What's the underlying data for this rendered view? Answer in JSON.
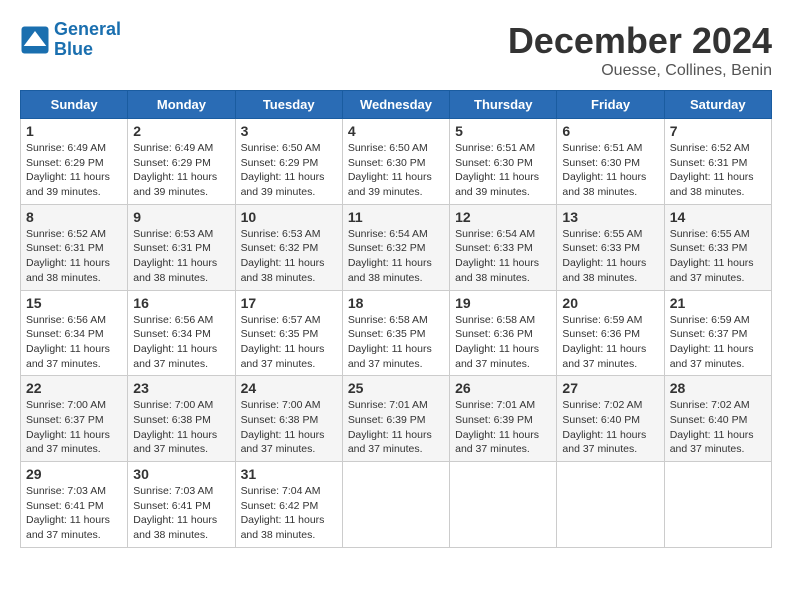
{
  "logo": {
    "text_general": "General",
    "text_blue": "Blue"
  },
  "header": {
    "month": "December 2024",
    "location": "Ouesse, Collines, Benin"
  },
  "weekdays": [
    "Sunday",
    "Monday",
    "Tuesday",
    "Wednesday",
    "Thursday",
    "Friday",
    "Saturday"
  ],
  "weeks": [
    [
      {
        "day": "1",
        "sunrise": "6:49 AM",
        "sunset": "6:29 PM",
        "daylight": "11 hours and 39 minutes."
      },
      {
        "day": "2",
        "sunrise": "6:49 AM",
        "sunset": "6:29 PM",
        "daylight": "11 hours and 39 minutes."
      },
      {
        "day": "3",
        "sunrise": "6:50 AM",
        "sunset": "6:29 PM",
        "daylight": "11 hours and 39 minutes."
      },
      {
        "day": "4",
        "sunrise": "6:50 AM",
        "sunset": "6:30 PM",
        "daylight": "11 hours and 39 minutes."
      },
      {
        "day": "5",
        "sunrise": "6:51 AM",
        "sunset": "6:30 PM",
        "daylight": "11 hours and 39 minutes."
      },
      {
        "day": "6",
        "sunrise": "6:51 AM",
        "sunset": "6:30 PM",
        "daylight": "11 hours and 38 minutes."
      },
      {
        "day": "7",
        "sunrise": "6:52 AM",
        "sunset": "6:31 PM",
        "daylight": "11 hours and 38 minutes."
      }
    ],
    [
      {
        "day": "8",
        "sunrise": "6:52 AM",
        "sunset": "6:31 PM",
        "daylight": "11 hours and 38 minutes."
      },
      {
        "day": "9",
        "sunrise": "6:53 AM",
        "sunset": "6:31 PM",
        "daylight": "11 hours and 38 minutes."
      },
      {
        "day": "10",
        "sunrise": "6:53 AM",
        "sunset": "6:32 PM",
        "daylight": "11 hours and 38 minutes."
      },
      {
        "day": "11",
        "sunrise": "6:54 AM",
        "sunset": "6:32 PM",
        "daylight": "11 hours and 38 minutes."
      },
      {
        "day": "12",
        "sunrise": "6:54 AM",
        "sunset": "6:33 PM",
        "daylight": "11 hours and 38 minutes."
      },
      {
        "day": "13",
        "sunrise": "6:55 AM",
        "sunset": "6:33 PM",
        "daylight": "11 hours and 38 minutes."
      },
      {
        "day": "14",
        "sunrise": "6:55 AM",
        "sunset": "6:33 PM",
        "daylight": "11 hours and 37 minutes."
      }
    ],
    [
      {
        "day": "15",
        "sunrise": "6:56 AM",
        "sunset": "6:34 PM",
        "daylight": "11 hours and 37 minutes."
      },
      {
        "day": "16",
        "sunrise": "6:56 AM",
        "sunset": "6:34 PM",
        "daylight": "11 hours and 37 minutes."
      },
      {
        "day": "17",
        "sunrise": "6:57 AM",
        "sunset": "6:35 PM",
        "daylight": "11 hours and 37 minutes."
      },
      {
        "day": "18",
        "sunrise": "6:58 AM",
        "sunset": "6:35 PM",
        "daylight": "11 hours and 37 minutes."
      },
      {
        "day": "19",
        "sunrise": "6:58 AM",
        "sunset": "6:36 PM",
        "daylight": "11 hours and 37 minutes."
      },
      {
        "day": "20",
        "sunrise": "6:59 AM",
        "sunset": "6:36 PM",
        "daylight": "11 hours and 37 minutes."
      },
      {
        "day": "21",
        "sunrise": "6:59 AM",
        "sunset": "6:37 PM",
        "daylight": "11 hours and 37 minutes."
      }
    ],
    [
      {
        "day": "22",
        "sunrise": "7:00 AM",
        "sunset": "6:37 PM",
        "daylight": "11 hours and 37 minutes."
      },
      {
        "day": "23",
        "sunrise": "7:00 AM",
        "sunset": "6:38 PM",
        "daylight": "11 hours and 37 minutes."
      },
      {
        "day": "24",
        "sunrise": "7:00 AM",
        "sunset": "6:38 PM",
        "daylight": "11 hours and 37 minutes."
      },
      {
        "day": "25",
        "sunrise": "7:01 AM",
        "sunset": "6:39 PM",
        "daylight": "11 hours and 37 minutes."
      },
      {
        "day": "26",
        "sunrise": "7:01 AM",
        "sunset": "6:39 PM",
        "daylight": "11 hours and 37 minutes."
      },
      {
        "day": "27",
        "sunrise": "7:02 AM",
        "sunset": "6:40 PM",
        "daylight": "11 hours and 37 minutes."
      },
      {
        "day": "28",
        "sunrise": "7:02 AM",
        "sunset": "6:40 PM",
        "daylight": "11 hours and 37 minutes."
      }
    ],
    [
      {
        "day": "29",
        "sunrise": "7:03 AM",
        "sunset": "6:41 PM",
        "daylight": "11 hours and 37 minutes."
      },
      {
        "day": "30",
        "sunrise": "7:03 AM",
        "sunset": "6:41 PM",
        "daylight": "11 hours and 38 minutes."
      },
      {
        "day": "31",
        "sunrise": "7:04 AM",
        "sunset": "6:42 PM",
        "daylight": "11 hours and 38 minutes."
      },
      null,
      null,
      null,
      null
    ]
  ]
}
